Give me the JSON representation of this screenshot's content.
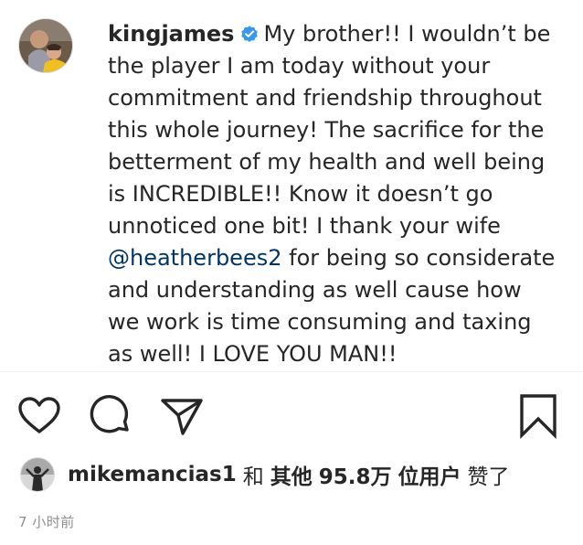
{
  "post": {
    "author": {
      "username": "kingjames",
      "verified": true,
      "avatar_icon": "profile-photo"
    },
    "caption": {
      "text_before_mention": "My brother!! I wouldn’t be the player I am today without your commitment and friendship throughout this whole journey! The sacrifice for the betterment of my health and well being is INCREDIBLE!! Know it doesn’t go unnoticed one bit! I thank your wife",
      "mention": "@heatherbees2",
      "text_after_mention": "for being so considerate and understanding as well cause how we work is time consuming and taxing as well! I LOVE YOU MAN!!"
    },
    "actions": {
      "like_icon": "heart-icon",
      "comment_icon": "comment-icon",
      "share_icon": "paper-plane-icon",
      "save_icon": "bookmark-icon"
    },
    "likes": {
      "liker_username": "mikemancias1",
      "conjunction": "和",
      "others_label": "其他",
      "count": "95.8万",
      "users_label": "位用户",
      "liked_text": "赞了"
    },
    "timestamp": "7 小时前"
  },
  "colors": {
    "text": "#262626",
    "mention": "#003569",
    "verified_badge": "#3897f0",
    "secondary_text": "#8e8e8e",
    "divider": "#efefef"
  }
}
